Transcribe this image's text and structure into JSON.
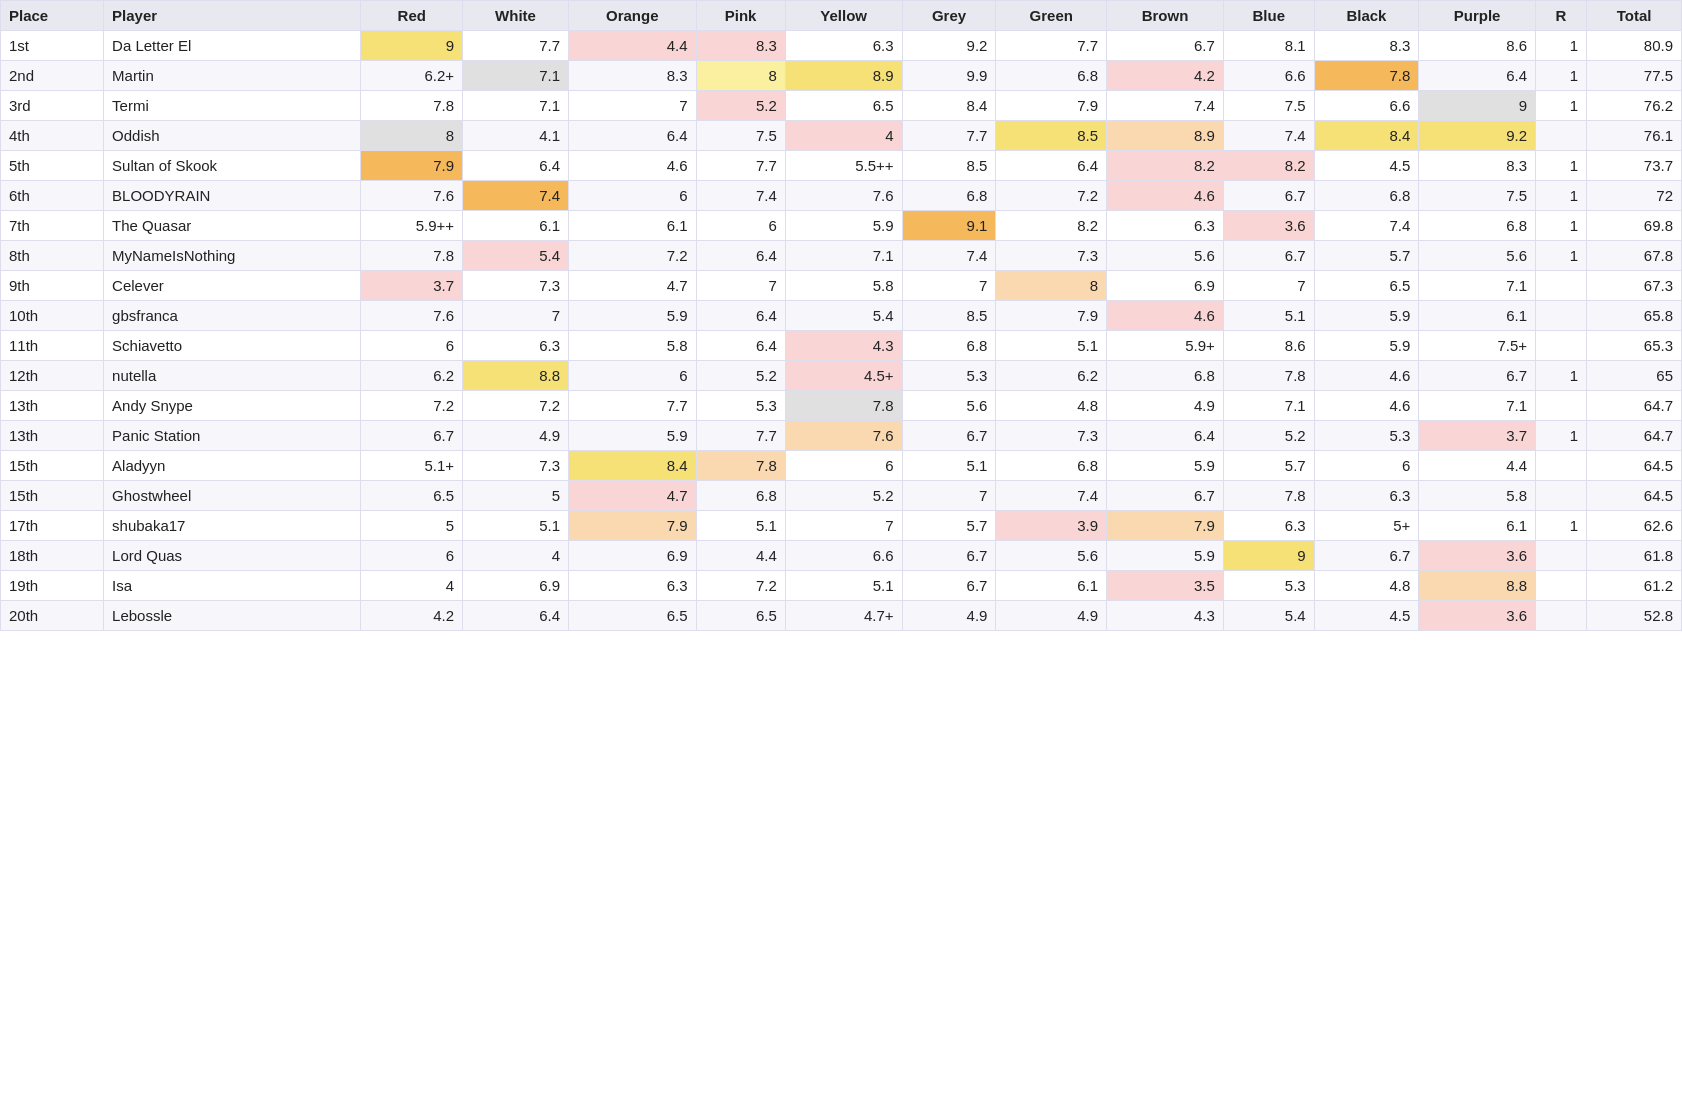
{
  "table": {
    "headers": [
      "Place",
      "Player",
      "Red",
      "White",
      "Orange",
      "Pink",
      "Yellow",
      "Grey",
      "Green",
      "Brown",
      "Blue",
      "Black",
      "Purple",
      "R",
      "Total"
    ],
    "rows": [
      {
        "place": "1st",
        "player": "Da Letter El",
        "red": "9",
        "red_class": "cell-yellow",
        "white": "7.7",
        "white_class": "",
        "orange": "4.4",
        "orange_class": "cell-light-pink",
        "pink": "8.3",
        "pink_class": "cell-light-pink",
        "yellow": "6.3",
        "yellow_class": "",
        "grey": "9.2",
        "grey_class": "",
        "green": "7.7",
        "green_class": "",
        "brown": "6.7",
        "brown_class": "",
        "blue": "8.1",
        "blue_class": "",
        "black": "8.3",
        "black_class": "",
        "purple": "8.6",
        "purple_class": "",
        "r": "1",
        "total": "80.9"
      },
      {
        "place": "2nd",
        "player": "Martin",
        "red": "6.2+",
        "red_class": "",
        "white": "7.1",
        "white_class": "cell-grey-light",
        "orange": "8.3",
        "orange_class": "",
        "pink": "8",
        "pink_class": "cell-light-yellow",
        "yellow": "8.9",
        "yellow_class": "cell-yellow",
        "grey": "9.9",
        "grey_class": "",
        "green": "6.8",
        "green_class": "",
        "brown": "4.2",
        "brown_class": "cell-light-pink",
        "blue": "6.6",
        "blue_class": "",
        "black": "7.8",
        "black_class": "cell-orange",
        "purple": "6.4",
        "purple_class": "",
        "r": "1",
        "total": "77.5"
      },
      {
        "place": "3rd",
        "player": "Termi",
        "red": "7.8",
        "red_class": "",
        "white": "7.1",
        "white_class": "",
        "orange": "7",
        "orange_class": "",
        "pink": "5.2",
        "pink_class": "cell-light-pink",
        "yellow": "6.5",
        "yellow_class": "",
        "grey": "8.4",
        "grey_class": "",
        "green": "7.9",
        "green_class": "",
        "brown": "7.4",
        "brown_class": "",
        "blue": "7.5",
        "blue_class": "",
        "black": "6.6",
        "black_class": "",
        "purple": "9",
        "purple_class": "cell-grey-light",
        "r": "1",
        "total": "76.2"
      },
      {
        "place": "4th",
        "player": "Oddish",
        "red": "8",
        "red_class": "cell-grey-light",
        "white": "4.1",
        "white_class": "",
        "orange": "6.4",
        "orange_class": "",
        "pink": "7.5",
        "pink_class": "",
        "yellow": "4",
        "yellow_class": "cell-light-pink",
        "grey": "7.7",
        "grey_class": "",
        "green": "8.5",
        "green_class": "cell-yellow",
        "brown": "8.9",
        "brown_class": "cell-light-orange",
        "blue": "7.4",
        "blue_class": "",
        "black": "8.4",
        "black_class": "cell-yellow",
        "purple": "9.2",
        "purple_class": "cell-yellow",
        "r": "",
        "total": "76.1"
      },
      {
        "place": "5th",
        "player": "Sultan of Skook",
        "red": "7.9",
        "red_class": "cell-orange",
        "white": "6.4",
        "white_class": "",
        "orange": "4.6",
        "orange_class": "",
        "pink": "7.7",
        "pink_class": "",
        "yellow": "5.5++",
        "yellow_class": "",
        "grey": "8.5",
        "grey_class": "",
        "green": "6.4",
        "green_class": "",
        "brown": "8.2",
        "brown_class": "cell-light-pink",
        "blue": "8.2",
        "blue_class": "cell-light-pink",
        "black": "4.5",
        "black_class": "",
        "purple": "8.3",
        "purple_class": "",
        "r": "1",
        "total": "73.7"
      },
      {
        "place": "6th",
        "player": "BLOODYRAIN",
        "red": "7.6",
        "red_class": "",
        "white": "7.4",
        "white_class": "cell-orange",
        "orange": "6",
        "orange_class": "",
        "pink": "7.4",
        "pink_class": "",
        "yellow": "7.6",
        "yellow_class": "",
        "grey": "6.8",
        "grey_class": "",
        "green": "7.2",
        "green_class": "",
        "brown": "4.6",
        "brown_class": "cell-light-pink",
        "blue": "6.7",
        "blue_class": "",
        "black": "6.8",
        "black_class": "",
        "purple": "7.5",
        "purple_class": "",
        "r": "1",
        "total": "72"
      },
      {
        "place": "7th",
        "player": "The Quasar",
        "red": "5.9++",
        "red_class": "",
        "white": "6.1",
        "white_class": "",
        "orange": "6.1",
        "orange_class": "",
        "pink": "6",
        "pink_class": "",
        "yellow": "5.9",
        "yellow_class": "",
        "grey": "9.1",
        "grey_class": "cell-orange",
        "green": "8.2",
        "green_class": "",
        "brown": "6.3",
        "brown_class": "",
        "blue": "3.6",
        "blue_class": "cell-light-pink",
        "black": "7.4",
        "black_class": "",
        "purple": "6.8",
        "purple_class": "",
        "r": "1",
        "total": "69.8"
      },
      {
        "place": "8th",
        "player": "MyNameIsNothing",
        "red": "7.8",
        "red_class": "",
        "white": "5.4",
        "white_class": "cell-light-pink",
        "orange": "7.2",
        "orange_class": "",
        "pink": "6.4",
        "pink_class": "",
        "yellow": "7.1",
        "yellow_class": "",
        "grey": "7.4",
        "grey_class": "",
        "green": "7.3",
        "green_class": "",
        "brown": "5.6",
        "brown_class": "",
        "blue": "6.7",
        "blue_class": "",
        "black": "5.7",
        "black_class": "",
        "purple": "5.6",
        "purple_class": "",
        "r": "1",
        "total": "67.8"
      },
      {
        "place": "9th",
        "player": "Celever",
        "red": "3.7",
        "red_class": "cell-light-pink",
        "white": "7.3",
        "white_class": "",
        "orange": "4.7",
        "orange_class": "",
        "pink": "7",
        "pink_class": "",
        "yellow": "5.8",
        "yellow_class": "",
        "grey": "7",
        "grey_class": "",
        "green": "8",
        "green_class": "cell-light-orange",
        "brown": "6.9",
        "brown_class": "",
        "blue": "7",
        "blue_class": "",
        "black": "6.5",
        "black_class": "",
        "purple": "7.1",
        "purple_class": "",
        "r": "",
        "total": "67.3"
      },
      {
        "place": "10th",
        "player": "gbsfranca",
        "red": "7.6",
        "red_class": "",
        "white": "7",
        "white_class": "",
        "orange": "5.9",
        "orange_class": "",
        "pink": "6.4",
        "pink_class": "",
        "yellow": "5.4",
        "yellow_class": "",
        "grey": "8.5",
        "grey_class": "",
        "green": "7.9",
        "green_class": "",
        "brown": "4.6",
        "brown_class": "cell-light-pink",
        "blue": "5.1",
        "blue_class": "",
        "black": "5.9",
        "black_class": "",
        "purple": "6.1",
        "purple_class": "",
        "r": "",
        "total": "65.8"
      },
      {
        "place": "11th",
        "player": "Schiavetto",
        "red": "6",
        "red_class": "",
        "white": "6.3",
        "white_class": "",
        "orange": "5.8",
        "orange_class": "",
        "pink": "6.4",
        "pink_class": "",
        "yellow": "4.3",
        "yellow_class": "cell-light-pink",
        "grey": "6.8",
        "grey_class": "",
        "green": "5.1",
        "green_class": "",
        "brown": "5.9+",
        "brown_class": "",
        "blue": "8.6",
        "blue_class": "",
        "black": "5.9",
        "black_class": "",
        "purple": "7.5+",
        "purple_class": "",
        "r": "",
        "total": "65.3"
      },
      {
        "place": "12th",
        "player": "nutella",
        "red": "6.2",
        "red_class": "",
        "white": "8.8",
        "white_class": "cell-yellow",
        "orange": "6",
        "orange_class": "",
        "pink": "5.2",
        "pink_class": "",
        "yellow": "4.5+",
        "yellow_class": "cell-light-pink",
        "grey": "5.3",
        "grey_class": "",
        "green": "6.2",
        "green_class": "",
        "brown": "6.8",
        "brown_class": "",
        "blue": "7.8",
        "blue_class": "",
        "black": "4.6",
        "black_class": "",
        "purple": "6.7",
        "purple_class": "",
        "r": "1",
        "total": "65"
      },
      {
        "place": "13th",
        "player": "Andy Snype",
        "red": "7.2",
        "red_class": "",
        "white": "7.2",
        "white_class": "",
        "orange": "7.7",
        "orange_class": "",
        "pink": "5.3",
        "pink_class": "",
        "yellow": "7.8",
        "yellow_class": "cell-grey-light",
        "grey": "5.6",
        "grey_class": "",
        "green": "4.8",
        "green_class": "",
        "brown": "4.9",
        "brown_class": "",
        "blue": "7.1",
        "blue_class": "",
        "black": "4.6",
        "black_class": "",
        "purple": "7.1",
        "purple_class": "",
        "r": "",
        "total": "64.7"
      },
      {
        "place": "13th",
        "player": "Panic Station",
        "red": "6.7",
        "red_class": "",
        "white": "4.9",
        "white_class": "",
        "orange": "5.9",
        "orange_class": "",
        "pink": "7.7",
        "pink_class": "",
        "yellow": "7.6",
        "yellow_class": "cell-light-orange",
        "grey": "6.7",
        "grey_class": "",
        "green": "7.3",
        "green_class": "",
        "brown": "6.4",
        "brown_class": "",
        "blue": "5.2",
        "blue_class": "",
        "black": "5.3",
        "black_class": "",
        "purple": "3.7",
        "purple_class": "cell-light-pink",
        "r": "1",
        "total": "64.7"
      },
      {
        "place": "15th",
        "player": "Aladyyn",
        "red": "5.1+",
        "red_class": "",
        "white": "7.3",
        "white_class": "",
        "orange": "8.4",
        "orange_class": "cell-yellow",
        "pink": "7.8",
        "pink_class": "cell-light-orange",
        "yellow": "6",
        "yellow_class": "",
        "grey": "5.1",
        "grey_class": "",
        "green": "6.8",
        "green_class": "",
        "brown": "5.9",
        "brown_class": "",
        "blue": "5.7",
        "blue_class": "",
        "black": "6",
        "black_class": "",
        "purple": "4.4",
        "purple_class": "",
        "r": "",
        "total": "64.5"
      },
      {
        "place": "15th",
        "player": "Ghostwheel",
        "red": "6.5",
        "red_class": "",
        "white": "5",
        "white_class": "",
        "orange": "4.7",
        "orange_class": "cell-light-pink",
        "pink": "6.8",
        "pink_class": "",
        "yellow": "5.2",
        "yellow_class": "",
        "grey": "7",
        "grey_class": "",
        "green": "7.4",
        "green_class": "",
        "brown": "6.7",
        "brown_class": "",
        "blue": "7.8",
        "blue_class": "",
        "black": "6.3",
        "black_class": "",
        "purple": "5.8",
        "purple_class": "",
        "r": "",
        "total": "64.5"
      },
      {
        "place": "17th",
        "player": "shubaka17",
        "red": "5",
        "red_class": "",
        "white": "5.1",
        "white_class": "",
        "orange": "7.9",
        "orange_class": "cell-light-orange",
        "pink": "5.1",
        "pink_class": "",
        "yellow": "7",
        "yellow_class": "",
        "grey": "5.7",
        "grey_class": "",
        "green": "3.9",
        "green_class": "cell-light-pink",
        "brown": "7.9",
        "brown_class": "cell-light-orange",
        "blue": "6.3",
        "blue_class": "",
        "black": "5+",
        "black_class": "",
        "purple": "6.1",
        "purple_class": "",
        "r": "1",
        "total": "62.6"
      },
      {
        "place": "18th",
        "player": "Lord Quas",
        "red": "6",
        "red_class": "",
        "white": "4",
        "white_class": "",
        "orange": "6.9",
        "orange_class": "",
        "pink": "4.4",
        "pink_class": "",
        "yellow": "6.6",
        "yellow_class": "",
        "grey": "6.7",
        "grey_class": "",
        "green": "5.6",
        "green_class": "",
        "brown": "5.9",
        "brown_class": "",
        "blue": "9",
        "blue_class": "cell-yellow",
        "black": "6.7",
        "black_class": "",
        "purple": "3.6",
        "purple_class": "cell-light-pink",
        "r": "",
        "total": "61.8"
      },
      {
        "place": "19th",
        "player": "Isa",
        "red": "4",
        "red_class": "",
        "white": "6.9",
        "white_class": "",
        "orange": "6.3",
        "orange_class": "",
        "pink": "7.2",
        "pink_class": "",
        "yellow": "5.1",
        "yellow_class": "",
        "grey": "6.7",
        "grey_class": "",
        "green": "6.1",
        "green_class": "",
        "brown": "3.5",
        "brown_class": "cell-light-pink",
        "blue": "5.3",
        "blue_class": "",
        "black": "4.8",
        "black_class": "",
        "purple": "8.8",
        "purple_class": "cell-light-orange",
        "r": "",
        "total": "61.2"
      },
      {
        "place": "20th",
        "player": "Lebossle",
        "red": "4.2",
        "red_class": "",
        "white": "6.4",
        "white_class": "",
        "orange": "6.5",
        "orange_class": "",
        "pink": "6.5",
        "pink_class": "",
        "yellow": "4.7+",
        "yellow_class": "",
        "grey": "4.9",
        "grey_class": "",
        "green": "4.9",
        "green_class": "",
        "brown": "4.3",
        "brown_class": "",
        "blue": "5.4",
        "blue_class": "",
        "black": "4.5",
        "black_class": "",
        "purple": "3.6",
        "purple_class": "cell-light-pink",
        "r": "",
        "total": "52.8"
      }
    ]
  }
}
